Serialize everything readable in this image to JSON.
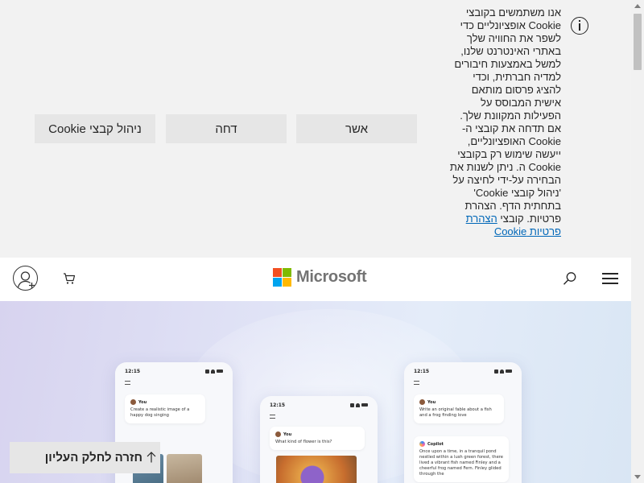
{
  "cookie_banner": {
    "message": "אנו משתמשים בקובצי Cookie אופציונליים כדי לשפר את החוויה שלך באתרי האינטרנט שלנו, למשל באמצעות חיבורים למדיה חברתית, וכדי להציג פרסום מותאם אישית המבוסס על הפעילות המקוונת שלך. אם תדחה את קובצי ה- Cookie האופציונליים, ייעשה שימוש רק בקובצי Cookie ה. ניתן לשנות את הבחירה על-ידי לחיצה על 'ניהול קובצי Cookie' בתחתית הדף. הצהרת פרטיות. קובצי",
    "privacy_link": "הצהרת פרטיות Cookie",
    "accept_label": "אשר",
    "reject_label": "דחה",
    "manage_label": "ניהול קבצי Cookie",
    "info_icon": "info-icon"
  },
  "header": {
    "brand": "Microsoft",
    "logo_colors": [
      "#f25022",
      "#7fba00",
      "#00a4ef",
      "#ffb900"
    ],
    "icons": [
      "account-icon",
      "cart-icon",
      "search-icon",
      "hamburger-menu-icon"
    ]
  },
  "hero": {
    "phone_1": {
      "time": "12:15",
      "user": "You",
      "message": "Create a realistic image of a happy dog singing"
    },
    "phone_2": {
      "time": "12:15",
      "user": "You",
      "message": "What kind of flower is this?"
    },
    "phone_3": {
      "time": "12:15",
      "user": "You",
      "message": "Write an original fable about a fish and a frog finding love",
      "assistant": "Copilot",
      "reply": "Once upon a time, in a tranquil pond nestled within a lush green forest, there lived a vibrant fish named Finley and a cheerful frog named Fern. Finley glided through the"
    }
  },
  "back_to_top": {
    "label": "חזרה לחלק העליון",
    "icon": "arrow-up-icon"
  }
}
